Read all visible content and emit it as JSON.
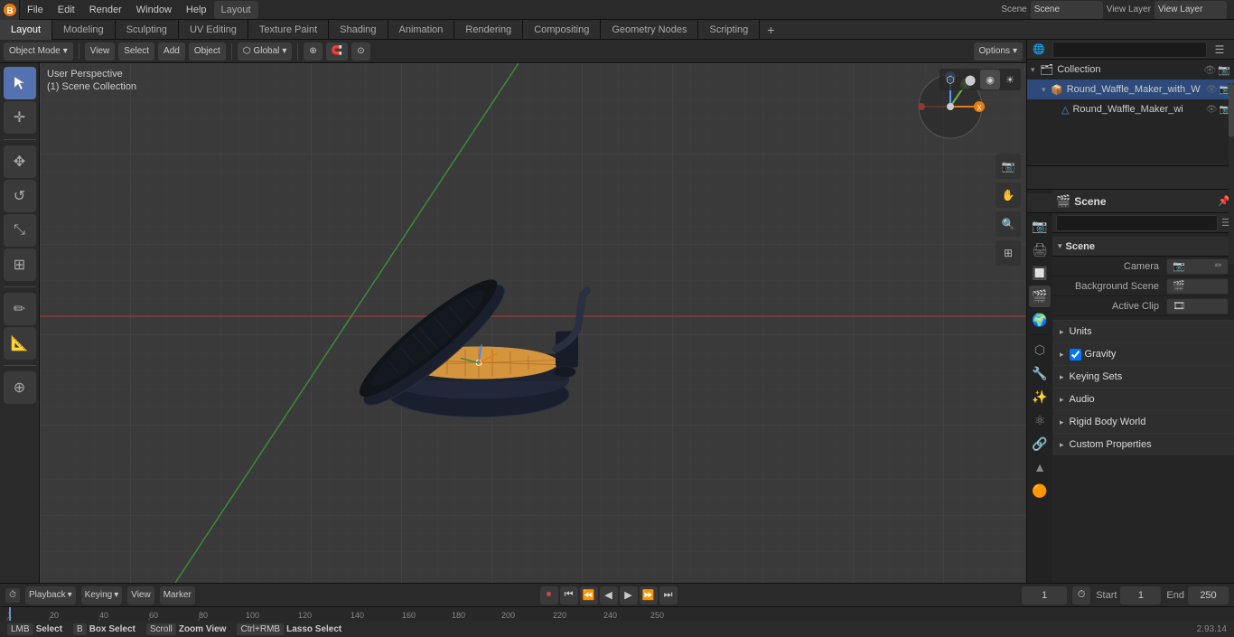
{
  "app": {
    "title": "Blender",
    "version": "2.93.14"
  },
  "top_menu": {
    "items": [
      "File",
      "Edit",
      "Render",
      "Window",
      "Help"
    ]
  },
  "workspace_tabs": {
    "tabs": [
      "Layout",
      "Modeling",
      "Sculpting",
      "UV Editing",
      "Texture Paint",
      "Shading",
      "Animation",
      "Rendering",
      "Compositing",
      "Geometry Nodes",
      "Scripting"
    ],
    "active": "Layout"
  },
  "editor_header": {
    "mode_btn": "Object Mode",
    "view_btn": "View",
    "select_btn": "Select",
    "add_btn": "Add",
    "object_btn": "Object",
    "transform_space": "Global",
    "options_btn": "Options"
  },
  "viewport": {
    "perspective_label": "User Perspective",
    "collection_label": "(1) Scene Collection"
  },
  "outliner": {
    "title": "Scene Collection",
    "search_placeholder": "",
    "items": [
      {
        "label": "Round_Waffle_Maker_with_W",
        "indent": 1,
        "icon": "📦",
        "has_arrow": true,
        "eye": true,
        "camera": true,
        "selected": true
      },
      {
        "label": "Round_Waffle_Maker_wi",
        "indent": 2,
        "icon": "▲",
        "has_arrow": false,
        "eye": true,
        "camera": true,
        "selected": false
      }
    ]
  },
  "properties": {
    "header_icon": "🎬",
    "header_title": "Scene",
    "scene_label": "Scene",
    "sub_section": "Scene",
    "camera_label": "Camera",
    "background_scene_label": "Background Scene",
    "active_clip_label": "Active Clip",
    "units_label": "Units",
    "gravity_label": "Gravity",
    "gravity_checked": true,
    "keying_sets_label": "Keying Sets",
    "audio_label": "Audio",
    "rigid_body_world_label": "Rigid Body World",
    "custom_properties_label": "Custom Properties"
  },
  "timeline": {
    "playback_btn": "Playback",
    "keying_btn": "Keying",
    "view_btn": "View",
    "marker_btn": "Marker",
    "current_frame": "1",
    "start_label": "Start",
    "start_value": "1",
    "end_label": "End",
    "end_value": "250",
    "ruler_marks": [
      "1",
      "20",
      "40",
      "60",
      "80",
      "100",
      "120",
      "140",
      "160",
      "180",
      "200",
      "220",
      "240",
      "250"
    ]
  },
  "status_bar": {
    "select_label": "Select",
    "box_select_label": "Box Select",
    "zoom_label": "Zoom View",
    "lasso_label": "Lasso Select",
    "version": "2.93.14"
  },
  "props_icons": [
    "🎬",
    "📷",
    "🎞",
    "✨",
    "🌊",
    "🔴",
    "💡",
    "🌍",
    "🔧"
  ],
  "collection_label": "Collection"
}
